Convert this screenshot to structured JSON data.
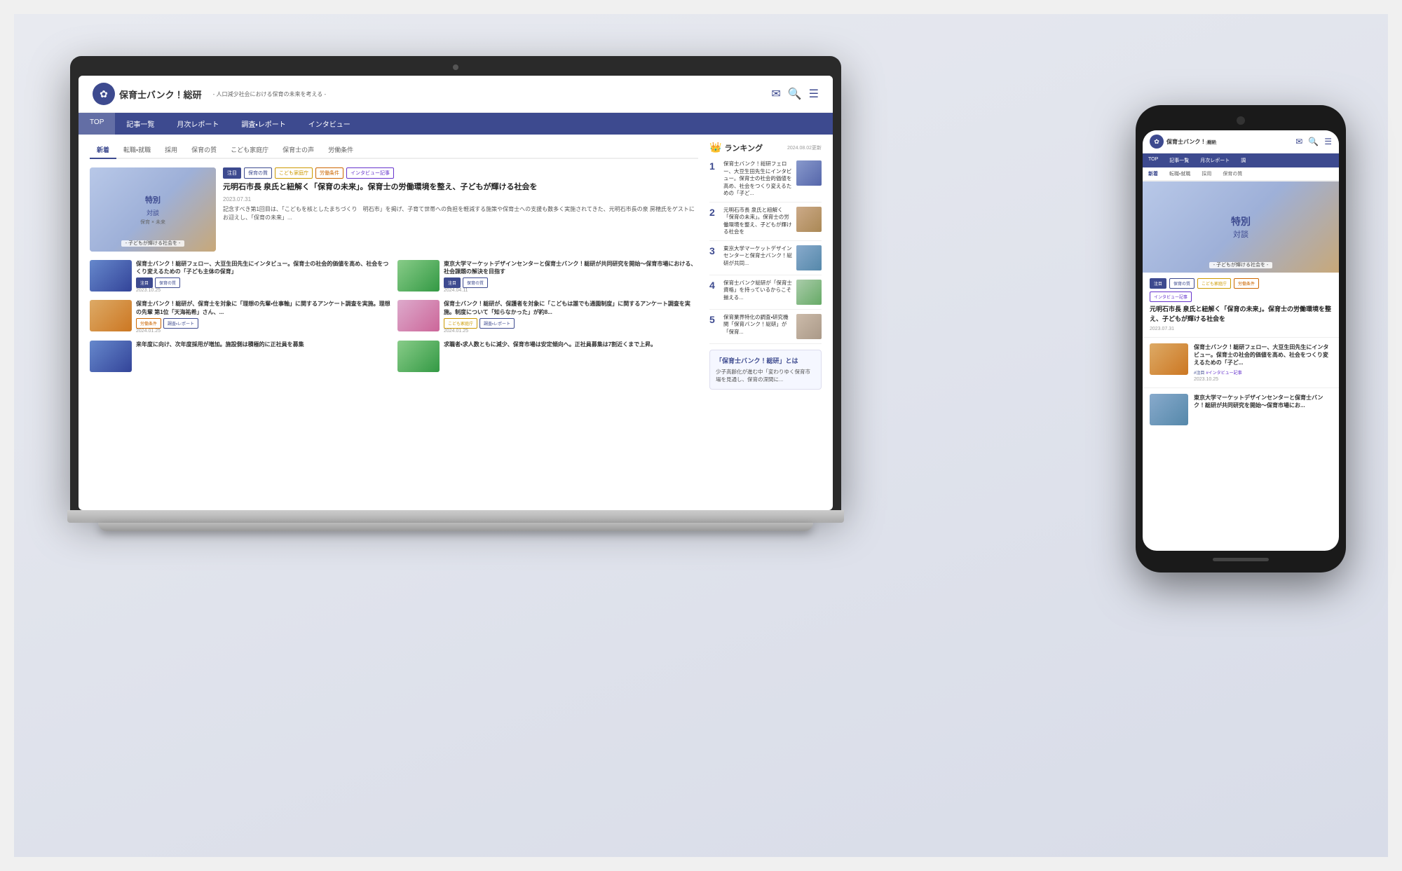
{
  "scene": {
    "background": "#e8eaf0"
  },
  "site": {
    "logo": {
      "icon": "✿",
      "name": "保育士バンク！総研",
      "sub_badge": "総研",
      "tagline": "- 人口減少社会における保育の未来を考える -"
    },
    "nav": {
      "items": [
        "TOP",
        "記事一覧",
        "月次レポート",
        "調査・レポート",
        "インタビュー"
      ]
    },
    "categories": [
      "新着",
      "転職・就職",
      "採用",
      "保育の質",
      "こども家庭庁",
      "保育士の声",
      "労働条件"
    ],
    "featured_article": {
      "tags": [
        "注目",
        "保育の質",
        "こども家庭庁",
        "労働条件",
        "インタビュー記事"
      ],
      "title": "元明石市長 泉氏と紐解く「保育の未来」。保育士の労働環境を整え、子どもが輝ける社会を",
      "date": "2023.07.31",
      "excerpt": "記念すべき第1回目は、「こどもを核としたまちづくり　明石市」を掲げ、子育て世帯への負担を軽減する施策や保育士への支援も数多く実施されてきた、元明石市長の泉 房穂氏をゲストにお迎えし、「保育の未来」..."
    },
    "articles": [
      {
        "title": "保育士バンク！総研フェロー、大豆生田先生にインタビュー。保育士の社会的価値を高め、社会をつくり変えるための「子ども主体の保育」",
        "tags": [
          "注目",
          "保育の質"
        ],
        "date": "2023.10.25",
        "img_class": "blue"
      },
      {
        "title": "東京大学マーケットデザインセンターと保育士バンク！総研が共同研究を開始～保育市場における、社会課題の解決を目指す",
        "tags": [
          "注目",
          "保育の質"
        ],
        "date": "2024.04.11",
        "img_class": "green"
      },
      {
        "title": "保育士バンク！総研が、保育士を対象に「理想の先輩・仕事軸」に関するアンケート調査を実施。理想の先輩 第1位「天海祐希」さん、...",
        "tags": [
          "労働条件",
          "調査・レポート"
        ],
        "date": "2024.01.25",
        "img_class": "orange"
      },
      {
        "title": "保育士バンク！総研が、保護者を対象に「こどもは誰でも通園制度」に関するアンケート調査を実施。制度について「知らなかった」が約8...",
        "tags": [
          "こども家庭庁",
          "調査・レポート"
        ],
        "date": "2024.01.25",
        "img_class": "pink"
      },
      {
        "title": "来年度に向け、次年度採用が増加。施設側は積極的に正社員を募集",
        "tags": [],
        "date": "",
        "img_class": "blue"
      },
      {
        "title": "求職者・求人数ともに減少、保育市場は安定傾向へ。正社員募集は7割近くまで上昇。",
        "tags": [],
        "date": "",
        "img_class": "green"
      }
    ],
    "ranking": {
      "title": "ランキング",
      "date": "2024.08.02更新",
      "items": [
        {
          "rank": "1",
          "text": "保育士バンク！総研フェロー、大豆生田先生にインタビュー。保育士の社会的価値を高め、社会をつくり変えるための「子ど...」",
          "img_class": "r1"
        },
        {
          "rank": "2",
          "text": "元明石市長 泉氏と紐解く「保育の未来」。保育士の労働環境を整え、子どもが輝ける社会を",
          "img_class": "r2"
        },
        {
          "rank": "3",
          "text": "東京大学マーケットデザインセンターと保育士バンク！総研が共同...",
          "img_class": "r3"
        },
        {
          "rank": "4",
          "text": "保育士バンク総研が「保育士資格」を持っているからこそ揃える...",
          "img_class": "r4"
        },
        {
          "rank": "5",
          "text": "保育業界特化の調査・研究機関「保育バンク！総研」が「保育...",
          "img_class": "r5"
        }
      ]
    },
    "about": {
      "title": "「保育士バンク！総研」とは",
      "text": "少子高齢化が進む中「変わりゆく保育市場を見通し、保育の深間に..."
    }
  },
  "phone": {
    "nav": [
      "TOP",
      "記事一覧",
      "月次レポート",
      "調"
    ],
    "categories": [
      "新着",
      "転職・就職",
      "採用",
      "保育の質"
    ],
    "featured_tags": [
      "注目",
      "保育の質",
      "こども家庭庁",
      "労働条件"
    ],
    "featured_extra_tag": "インタビュー記事",
    "featured_title": "元明石市長 泉氏と紐解く「保育の未来」。保育士の労働環境を整え、子どもが輝ける社会を",
    "featured_date": "2023.07.31",
    "small_articles": [
      {
        "title": "保育士バンク！総研フェロー、大豆生田先生にインタビュー。保育士の社会的価値を高め、社会をつくり変えるための「子ど...",
        "tags": [
          "#注目",
          "#インタビュー記事"
        ],
        "date": "2023.10.25",
        "img_class": "orange"
      },
      {
        "title": "東京大学マーケットデザインセンターと保育士バンク！総研が共同研究を開始～保育市場にお...",
        "tags": [],
        "date": "",
        "img_class": ""
      }
    ]
  },
  "icons": {
    "mail": "✉",
    "search": "🔍",
    "menu": "☰",
    "crown": "👑"
  }
}
